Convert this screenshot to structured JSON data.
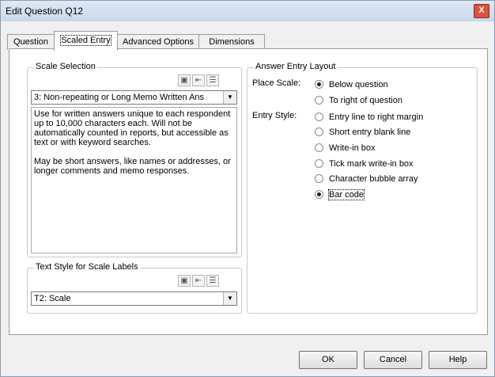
{
  "window": {
    "title": "Edit Question Q12",
    "close_label": "X"
  },
  "tabs": [
    {
      "label": "Question",
      "active": false
    },
    {
      "label": "Scaled Entry",
      "active": true
    },
    {
      "label": "Advanced Options",
      "active": false
    },
    {
      "label": "Dimensions",
      "active": false
    }
  ],
  "scale_selection": {
    "legend": "Scale Selection",
    "icons": [
      "camera-icon",
      "insert-arrow-icon",
      "list-icon"
    ],
    "selected_value": "3: Non-repeating or Long Memo Written Ans",
    "description_p1": "Use for written answers unique to each respondent up to 10,000 characters each.  Will not be automatically counted in reports, but accessible as text or with keyword searches.",
    "description_p2": "May be short answers, like names or addresses, or longer comments and memo responses."
  },
  "text_style": {
    "legend": "Text Style for Scale Labels",
    "icons": [
      "camera-icon",
      "insert-arrow-icon",
      "list-icon"
    ],
    "selected_value": "T2: Scale"
  },
  "answer_entry": {
    "legend": "Answer Entry Layout",
    "place_scale_label": "Place Scale:",
    "place_scale_options": [
      {
        "label": "Below question",
        "checked": true
      },
      {
        "label": "To right of question",
        "checked": false
      }
    ],
    "entry_style_label": "Entry Style:",
    "entry_style_options": [
      {
        "label": "Entry line to right margin",
        "checked": false
      },
      {
        "label": "Short entry blank line",
        "checked": false
      },
      {
        "label": "Write-in box",
        "checked": false
      },
      {
        "label": "Tick mark write-in box",
        "checked": false
      },
      {
        "label": "Character bubble array",
        "checked": false
      },
      {
        "label": "Bar code",
        "checked": true
      }
    ]
  },
  "buttons": {
    "ok": "OK",
    "cancel": "Cancel",
    "help": "Help"
  }
}
